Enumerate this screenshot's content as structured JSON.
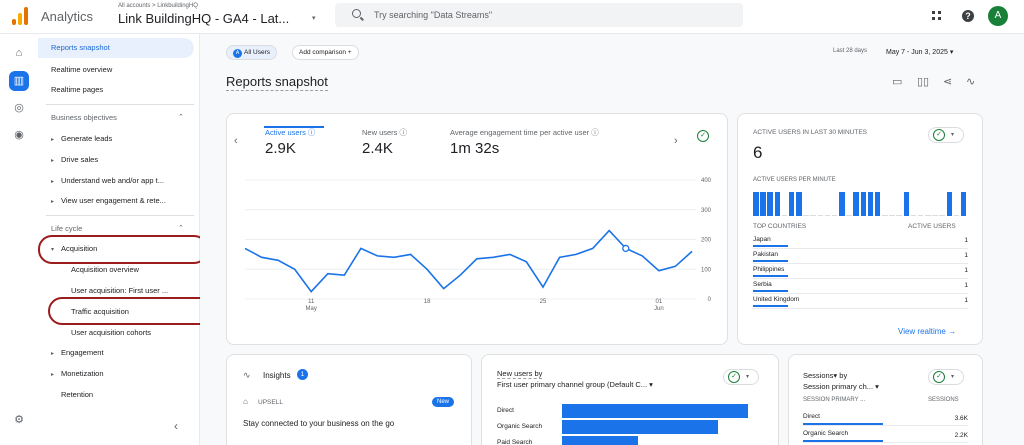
{
  "header": {
    "app_name": "Analytics",
    "breadcrumb": "All accounts > LinkbuildingHQ",
    "property": "Link BuildingHQ - GA4 - Lat...",
    "search_placeholder": "Try searching \"Data Streams\"",
    "avatar_letter": "A",
    "brand_colors": {
      "accent": "#1a73e8",
      "logo_dark": "#e37400",
      "logo_light": "#f9ab00",
      "avatar": "#188038"
    }
  },
  "sidebar": {
    "top_items": [
      "Reports snapshot",
      "Realtime overview",
      "Realtime pages"
    ],
    "business_objectives": {
      "title": "Business objectives",
      "items": [
        "Generate leads",
        "Drive sales",
        "Understand web and/or app t...",
        "View user engagement & rete..."
      ]
    },
    "life_cycle": {
      "title": "Life cycle",
      "acquisition": "Acquisition",
      "acquisition_sub": [
        "Acquisition overview",
        "User acquisition: First user ...",
        "Traffic acquisition",
        "User acquisition cohorts"
      ],
      "items": [
        "Engagement",
        "Monetization",
        "Retention"
      ]
    }
  },
  "toolbar": {
    "all_users_chip": "All Users",
    "all_users_letter": "A",
    "add_comparison": "Add comparison +",
    "date_range_label": "Last 28 days",
    "date_range": "May 7 - Jun 3, 2025 ▾"
  },
  "page": {
    "title": "Reports snapshot"
  },
  "kpis": [
    {
      "label": "Active users ⓘ",
      "value": "2.9K"
    },
    {
      "label": "New users ⓘ",
      "value": "2.4K"
    },
    {
      "label": "Average engagement time per active user ⓘ",
      "value": "1m 32s"
    }
  ],
  "chart_data": {
    "type": "line",
    "x": [
      "May 7",
      "May 8",
      "May 9",
      "May 10",
      "May 11",
      "May 12",
      "May 13",
      "May 14",
      "May 15",
      "May 16",
      "May 17",
      "May 18",
      "May 19",
      "May 20",
      "May 21",
      "May 22",
      "May 23",
      "May 24",
      "May 25",
      "May 26",
      "May 27",
      "May 28",
      "May 29",
      "May 30",
      "May 31",
      "Jun 1",
      "Jun 2",
      "Jun 3"
    ],
    "series": [
      {
        "values": [
          170,
          140,
          130,
          100,
          25,
          85,
          80,
          170,
          145,
          140,
          150,
          100,
          35,
          80,
          135,
          140,
          150,
          125,
          40,
          140,
          150,
          170,
          230,
          170,
          145,
          95,
          110,
          160
        ]
      }
    ],
    "x_tick_labels": [
      "11\nMay",
      "18",
      "25",
      "01\nJun"
    ],
    "y_tick_labels": [
      "400",
      "300",
      "200",
      "100",
      "0"
    ],
    "ylim": [
      0,
      400
    ],
    "grid": true,
    "color": "#1a73e8"
  },
  "realtime": {
    "title": "ACTIVE USERS IN LAST 30 MINUTES",
    "value": "6",
    "per_minute_label": "ACTIVE USERS PER MINUTE",
    "per_minute_bars": [
      1,
      1,
      1,
      1,
      0,
      1,
      1,
      0,
      0,
      0,
      0,
      0,
      1,
      0,
      1,
      1,
      1,
      1,
      0,
      0,
      0,
      1,
      0,
      0,
      0,
      0,
      0,
      1,
      0,
      1
    ],
    "col_country": "TOP COUNTRIES",
    "col_users": "ACTIVE USERS",
    "rows": [
      {
        "country": "Japan",
        "users": "1"
      },
      {
        "country": "Pakistan",
        "users": "1"
      },
      {
        "country": "Philippines",
        "users": "1"
      },
      {
        "country": "Serbia",
        "users": "1"
      },
      {
        "country": "United Kingdom",
        "users": "1"
      }
    ],
    "view_link": "View realtime →"
  },
  "insights": {
    "title": "Insights",
    "count": "1",
    "tag": "UPSELL",
    "new_badge": "New",
    "text": "Stay connected to your business on the go"
  },
  "new_users_card": {
    "title": "New users by",
    "subtitle": "First user primary channel group (Default C... ▾",
    "rows": [
      {
        "label": "Direct",
        "value": 0.98
      },
      {
        "label": "Organic Search",
        "value": 0.82
      },
      {
        "label": "Paid Search",
        "value": 0.4
      }
    ]
  },
  "sessions_card": {
    "title": "Sessions▾ by",
    "subtitle": "Session primary ch... ▾",
    "col_a": "SESSION PRIMARY ...",
    "col_b": "SESSIONS",
    "rows": [
      {
        "label": "Direct",
        "value": "3.6K"
      },
      {
        "label": "Organic Search",
        "value": "2.2K"
      }
    ]
  },
  "icons": {
    "check": "✓",
    "caret": "▾",
    "chevron_up": "⌃",
    "right": "▸",
    "down": "▾",
    "prev": "‹",
    "next": "›",
    "collapse": "‹",
    "sparkline": "∿",
    "tag": "⌂",
    "insights": "⋰",
    "help": "?",
    "home": "⌂",
    "reports": "▥",
    "explore": "◎",
    "advertising": "◉",
    "settings": "⚙",
    "share": "⋖",
    "edit": "▭",
    "compare": "▯▯"
  }
}
